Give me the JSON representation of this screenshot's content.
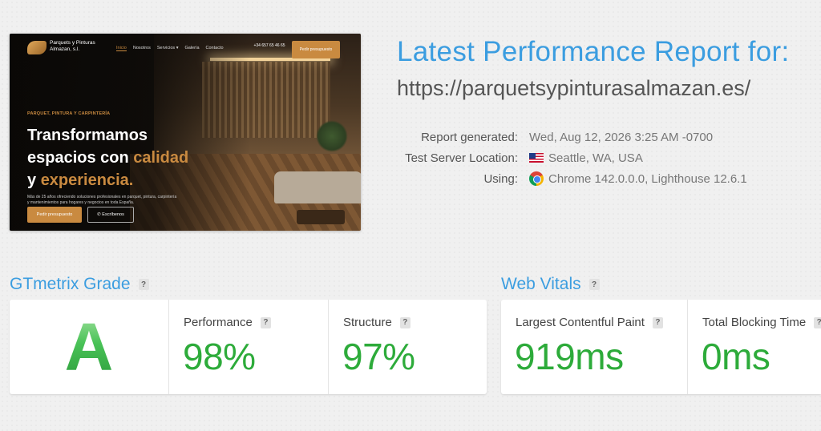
{
  "site_preview": {
    "brand": "Parquets y Pinturas Almazan, s.l.",
    "menu": [
      "Inicio",
      "Nosotros",
      "Servicios ▾",
      "Galería",
      "Contacto"
    ],
    "phone": "+34 657 65 46 65",
    "cta_top": "Pedir presupuesto",
    "eyebrow": "PARQUET, PINTURA Y CARPINTERÍA",
    "headline_1": "Transformamos",
    "headline_2": "espacios con ",
    "headline_hl1": "calidad",
    "headline_3": "y ",
    "headline_hl2": "experiencia.",
    "subtext": "Más de 25 años ofreciendo soluciones profesionales en parquet, pintura, carpintería y mantenimientos para hogares y negocios en toda España.",
    "btn_primary": "Pedir presupuesto",
    "btn_secondary": "✆ Escríbenos"
  },
  "report": {
    "title": "Latest Performance Report for:",
    "url": "https://parquetsypinturasalmazan.es/",
    "meta": [
      {
        "label": "Report generated:",
        "value": "Wed, Aug 12, 2026 3:25 AM -0700",
        "icon": "none"
      },
      {
        "label": "Test Server Location:",
        "value": "Seattle, WA, USA",
        "icon": "us-flag-icon"
      },
      {
        "label": "Using:",
        "value": "Chrome 142.0.0.0, Lighthouse 12.6.1",
        "icon": "chrome-icon"
      }
    ]
  },
  "grade": {
    "title": "GTmetrix Grade",
    "help": "?",
    "letter": "A",
    "performance_label": "Performance",
    "performance_value": "98%",
    "structure_label": "Structure",
    "structure_value": "97%"
  },
  "vitals": {
    "title": "Web Vitals",
    "help": "?",
    "lcp_label": "Largest Contentful Paint",
    "lcp_value": "919ms",
    "tbt_label": "Total Blocking Time",
    "tbt_value": "0ms"
  },
  "colors": {
    "accent_blue": "#3b9de0",
    "good_green": "#2dab3a",
    "brand_gold": "#c98a40"
  }
}
